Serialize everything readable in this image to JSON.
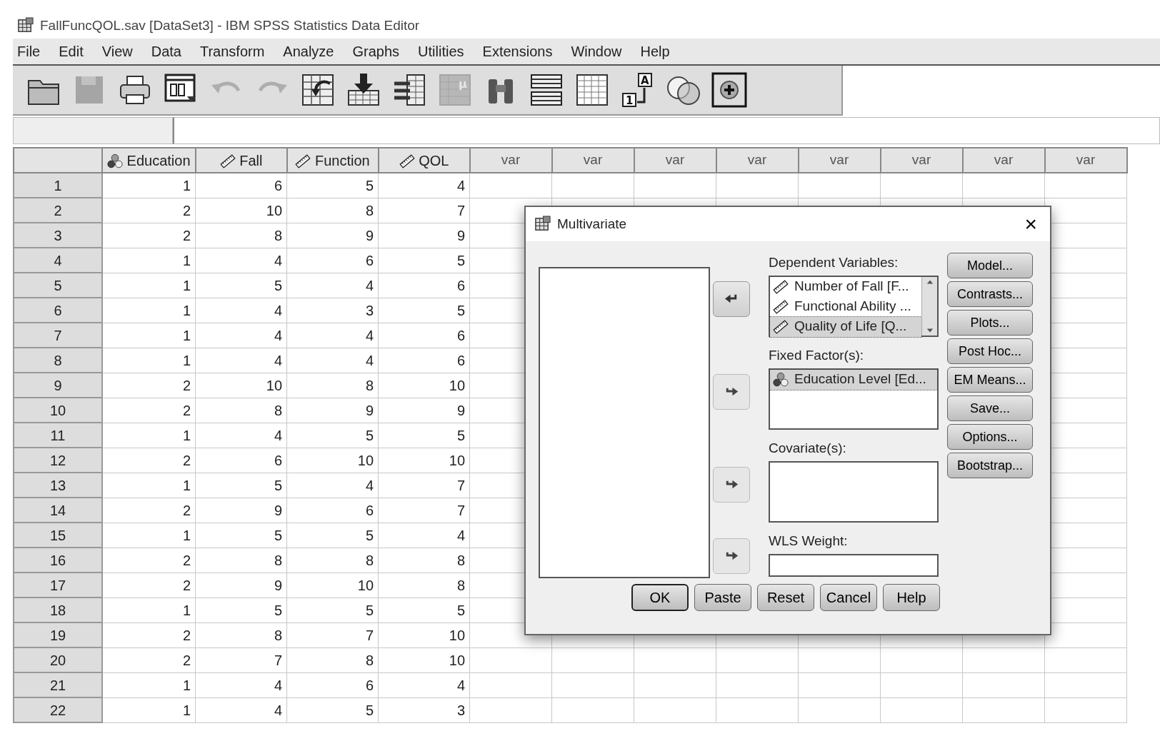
{
  "window": {
    "title": "FallFuncQOL.sav [DataSet3] - IBM SPSS Statistics Data Editor"
  },
  "menu": [
    "File",
    "Edit",
    "View",
    "Data",
    "Transform",
    "Analyze",
    "Graphs",
    "Utilities",
    "Extensions",
    "Window",
    "Help"
  ],
  "toolbar": [
    {
      "kind": "folder",
      "disabled": false
    },
    {
      "kind": "disk",
      "disabled": true
    },
    {
      "kind": "printer",
      "disabled": false
    },
    {
      "kind": "dialog",
      "disabled": false
    },
    {
      "kind": "undo",
      "disabled": true
    },
    {
      "kind": "redo",
      "disabled": true
    },
    {
      "kind": "goto",
      "disabled": false
    },
    {
      "kind": "download",
      "disabled": false
    },
    {
      "kind": "columns",
      "disabled": false
    },
    {
      "kind": "mu",
      "disabled": true,
      "glyphs": [
        "μ"
      ]
    },
    {
      "kind": "binoculars",
      "disabled": false
    },
    {
      "kind": "split",
      "disabled": false
    },
    {
      "kind": "grid",
      "disabled": false
    },
    {
      "kind": "labels",
      "disabled": false,
      "glyphs": [
        "A",
        "1"
      ]
    },
    {
      "kind": "circles",
      "disabled": false
    },
    {
      "kind": "plus",
      "disabled": false
    }
  ],
  "grid": {
    "columns": [
      {
        "label": "Education",
        "kind": "nominal"
      },
      {
        "label": "Fall",
        "kind": "scale"
      },
      {
        "label": "Function",
        "kind": "scale"
      },
      {
        "label": "QOL",
        "kind": "scale"
      },
      {
        "label": "var",
        "kind": "empty"
      },
      {
        "label": "var",
        "kind": "empty"
      },
      {
        "label": "var",
        "kind": "empty"
      },
      {
        "label": "var",
        "kind": "empty"
      },
      {
        "label": "var",
        "kind": "empty"
      },
      {
        "label": "var",
        "kind": "empty"
      },
      {
        "label": "var",
        "kind": "empty"
      },
      {
        "label": "var",
        "kind": "empty"
      }
    ],
    "rows": [
      {
        "header": "1",
        "cells": [
          "1",
          "6",
          "5",
          "4"
        ]
      },
      {
        "header": "2",
        "cells": [
          "2",
          "10",
          "8",
          "7"
        ]
      },
      {
        "header": "3",
        "cells": [
          "2",
          "8",
          "9",
          "9"
        ]
      },
      {
        "header": "4",
        "cells": [
          "1",
          "4",
          "6",
          "5"
        ]
      },
      {
        "header": "5",
        "cells": [
          "1",
          "5",
          "4",
          "6"
        ]
      },
      {
        "header": "6",
        "cells": [
          "1",
          "4",
          "3",
          "5"
        ]
      },
      {
        "header": "7",
        "cells": [
          "1",
          "4",
          "4",
          "6"
        ]
      },
      {
        "header": "8",
        "cells": [
          "1",
          "4",
          "4",
          "6"
        ]
      },
      {
        "header": "9",
        "cells": [
          "2",
          "10",
          "8",
          "10"
        ]
      },
      {
        "header": "10",
        "cells": [
          "2",
          "8",
          "9",
          "9"
        ]
      },
      {
        "header": "11",
        "cells": [
          "1",
          "4",
          "5",
          "5"
        ]
      },
      {
        "header": "12",
        "cells": [
          "2",
          "6",
          "10",
          "10"
        ]
      },
      {
        "header": "13",
        "cells": [
          "1",
          "5",
          "4",
          "7"
        ]
      },
      {
        "header": "14",
        "cells": [
          "2",
          "9",
          "6",
          "7"
        ]
      },
      {
        "header": "15",
        "cells": [
          "1",
          "5",
          "5",
          "4"
        ]
      },
      {
        "header": "16",
        "cells": [
          "2",
          "8",
          "8",
          "8"
        ]
      },
      {
        "header": "17",
        "cells": [
          "2",
          "9",
          "10",
          "8"
        ]
      },
      {
        "header": "18",
        "cells": [
          "1",
          "5",
          "5",
          "5"
        ]
      },
      {
        "header": "19",
        "cells": [
          "2",
          "8",
          "7",
          "10"
        ]
      },
      {
        "header": "20",
        "cells": [
          "2",
          "7",
          "8",
          "10"
        ]
      },
      {
        "header": "21",
        "cells": [
          "1",
          "4",
          "6",
          "4"
        ]
      },
      {
        "header": "22",
        "cells": [
          "1",
          "4",
          "5",
          "3"
        ]
      }
    ]
  },
  "dialog": {
    "title": "Multivariate",
    "close": "×",
    "targets": [
      {
        "label": "Dependent Variables:",
        "kind": "list",
        "arrow_left": true,
        "arrow_disabled": false,
        "items": [
          {
            "text": "Number of Fall [F...",
            "kind": "scale",
            "selected": false
          },
          {
            "text": "Functional Ability ...",
            "kind": "scale",
            "selected": false
          },
          {
            "text": "Quality of Life [Q...",
            "kind": "scale",
            "selected": true
          }
        ]
      },
      {
        "label": "Fixed Factor(s):",
        "kind": "list",
        "arrow_left": false,
        "arrow_disabled": true,
        "items": [
          {
            "text": "Education Level [Ed...",
            "kind": "nominal",
            "selected": true
          }
        ]
      },
      {
        "label": "Covariate(s):",
        "kind": "list",
        "arrow_left": false,
        "arrow_disabled": true
      },
      {
        "label": "WLS Weight:",
        "kind": "field",
        "arrow_left": false,
        "arrow_disabled": true
      }
    ],
    "side_buttons": [
      "Model...",
      "Contrasts...",
      "Plots...",
      "Post Hoc...",
      "EM Means...",
      "Save...",
      "Options...",
      "Bootstrap..."
    ],
    "bottom_buttons": [
      {
        "label": "OK",
        "default": true
      },
      {
        "label": "Paste",
        "default": false
      },
      {
        "label": "Reset",
        "default": false
      },
      {
        "label": "Cancel",
        "default": false
      },
      {
        "label": "Help",
        "default": false
      }
    ]
  }
}
